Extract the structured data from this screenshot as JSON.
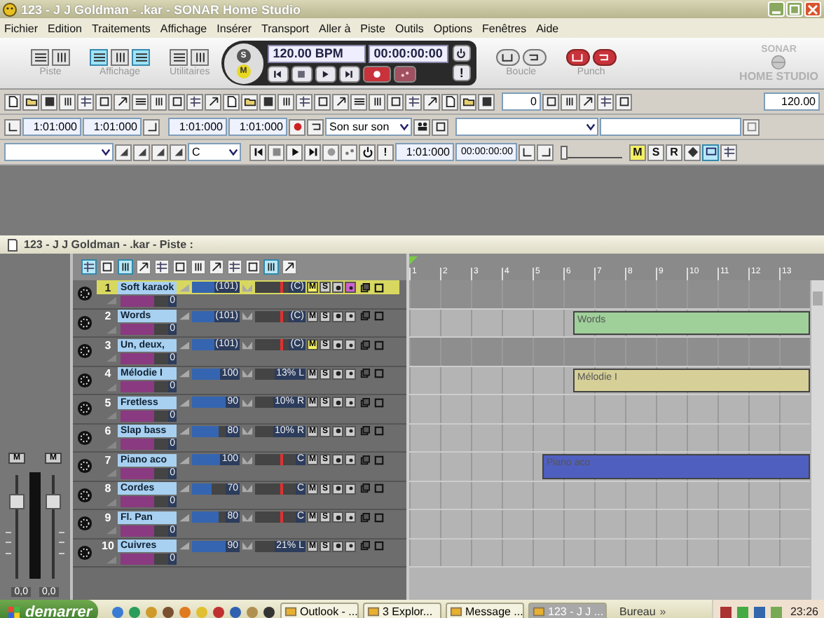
{
  "window": {
    "title": "123 - J J Goldman - .kar - SONAR Home Studio"
  },
  "menu": [
    "Fichier",
    "Edition",
    "Traitements",
    "Affichage",
    "Insérer",
    "Transport",
    "Aller à",
    "Piste",
    "Outils",
    "Options",
    "Fenêtres",
    "Aide"
  ],
  "main_toolbar": {
    "groups": [
      {
        "label": "Piste",
        "kind": "plain"
      },
      {
        "label": "Affichage",
        "kind": "view",
        "buttons": [
          {
            "on": true
          },
          {
            "on": false
          },
          {
            "on": true
          }
        ]
      },
      {
        "label": "Utilitaires",
        "kind": "plain"
      }
    ],
    "transport": {
      "mode_buttons": [
        {
          "label": "S",
          "on": false
        },
        {
          "label": "M",
          "on": true
        }
      ],
      "tempo": "120.00 BPM",
      "time": "00:00:00:00",
      "alert": "!"
    },
    "right_groups": [
      {
        "label": "Boucle",
        "kind": "plain"
      },
      {
        "label": "Punch",
        "kind": "punch",
        "buttons": [
          {
            "on": true
          },
          {
            "on": true
          }
        ]
      }
    ],
    "logo": {
      "line1": "SONAR",
      "line2": "HOME STUDIO"
    }
  },
  "toolbar2": {
    "fields": [
      "0",
      "120.00"
    ]
  },
  "toolbar3": {
    "times": [
      "1:01:000",
      "1:01:000",
      "1:01:000",
      "1:01:000"
    ],
    "mode_select": "Son sur son"
  },
  "toolbar4": {
    "key_select": "C",
    "alert": "!",
    "now": "1:01:000",
    "smpte": "00:00:00:00",
    "zoom": {
      "level": 0
    },
    "buttons": [
      {
        "label": "M",
        "on": true
      },
      {
        "label": "S",
        "on": false
      },
      {
        "label": "R",
        "on": false
      }
    ]
  },
  "track_window": {
    "title": "123 - J J Goldman - .kar - Piste :",
    "master": {
      "mute_buttons": [
        "M",
        "M"
      ],
      "readings": [
        "0,0",
        "0,0"
      ]
    },
    "ruler": [
      "1",
      "2",
      "3",
      "4",
      "5",
      "6",
      "7",
      "8",
      "9",
      "10",
      "11",
      "12",
      "13"
    ],
    "tracks": [
      {
        "number": "1",
        "mute_label": "M",
        "solo_label": "S",
        "name": "Soft karaok",
        "selected": true,
        "muted": true,
        "echo": true,
        "volume": {
          "reading": "(101)",
          "level": 0.95
        },
        "pan": {
          "reading": "(C)",
          "level": 0.5
        },
        "send": {
          "reading": "0",
          "level": 0.6
        }
      },
      {
        "number": "2",
        "mute_label": "M",
        "solo_label": "S",
        "name": "Words",
        "selected": false,
        "muted": false,
        "echo": false,
        "volume": {
          "reading": "(101)",
          "level": 0.95
        },
        "pan": {
          "reading": "(C)",
          "level": 0.5
        },
        "send": {
          "reading": "0",
          "level": 0.6
        },
        "clip": {
          "label": "Words",
          "color": "#9fd09a"
        }
      },
      {
        "number": "3",
        "mute_label": "M",
        "solo_label": "S",
        "name": "Un, deux,",
        "selected": false,
        "muted": true,
        "echo": false,
        "volume": {
          "reading": "(101)",
          "level": 0.95
        },
        "pan": {
          "reading": "(C)",
          "level": 0.5
        },
        "send": {
          "reading": "0",
          "level": 0.6
        }
      },
      {
        "number": "4",
        "mute_label": "M",
        "solo_label": "S",
        "name": "Mélodie I",
        "selected": false,
        "muted": false,
        "echo": false,
        "volume": {
          "reading": "100",
          "level": 0.9
        },
        "pan": {
          "reading": "13% L",
          "level": 0.43
        },
        "send": {
          "reading": "0",
          "level": 0.6
        },
        "clip": {
          "label": "Mélodie I",
          "color": "#d6cf98"
        }
      },
      {
        "number": "5",
        "mute_label": "M",
        "solo_label": "S",
        "name": "Fretless",
        "selected": false,
        "muted": false,
        "echo": false,
        "volume": {
          "reading": "90",
          "level": 0.7
        },
        "pan": {
          "reading": "10% R",
          "level": 0.55
        },
        "send": {
          "reading": "0",
          "level": 0.6
        }
      },
      {
        "number": "6",
        "mute_label": "M",
        "solo_label": "S",
        "name": "Slap bass",
        "selected": false,
        "muted": false,
        "echo": false,
        "volume": {
          "reading": "80",
          "level": 0.55
        },
        "pan": {
          "reading": "10% R",
          "level": 0.55
        },
        "send": {
          "reading": "0",
          "level": 0.6
        }
      },
      {
        "number": "7",
        "mute_label": "M",
        "solo_label": "S",
        "name": "Piano aco",
        "selected": false,
        "muted": false,
        "echo": false,
        "volume": {
          "reading": "100",
          "level": 0.9
        },
        "pan": {
          "reading": "C",
          "level": 0.5
        },
        "send": {
          "reading": "0",
          "level": 0.6
        },
        "clip": {
          "label": "Piano aco",
          "color": "#4f5fc0"
        }
      },
      {
        "number": "8",
        "mute_label": "M",
        "solo_label": "S",
        "name": "Cordes",
        "selected": false,
        "muted": false,
        "echo": false,
        "volume": {
          "reading": "70",
          "level": 0.4
        },
        "pan": {
          "reading": "C",
          "level": 0.5
        },
        "send": {
          "reading": "0",
          "level": 0.6
        }
      },
      {
        "number": "9",
        "mute_label": "M",
        "solo_label": "S",
        "name": "Fl. Pan",
        "selected": false,
        "muted": false,
        "echo": false,
        "volume": {
          "reading": "80",
          "level": 0.55
        },
        "pan": {
          "reading": "C",
          "level": 0.5
        },
        "send": {
          "reading": "0",
          "level": 0.6
        }
      },
      {
        "number": "10",
        "mute_label": "M",
        "solo_label": "S",
        "name": "Cuivres",
        "selected": false,
        "muted": false,
        "echo": false,
        "volume": {
          "reading": "90",
          "level": 0.7
        },
        "pan": {
          "reading": "21% L",
          "level": 0.4
        },
        "send": {
          "reading": "0",
          "level": 0.6
        }
      }
    ]
  },
  "taskbar": {
    "start": "demarrer",
    "tasks": [
      {
        "label": "Outlook - ...",
        "selected": false
      },
      {
        "label": "3 Explor...",
        "selected": false
      },
      {
        "label": "Message ...",
        "selected": false
      },
      {
        "label": "123 - J J ...",
        "selected": true
      }
    ],
    "toolbar_label": "Bureau",
    "more": "»",
    "clock": "23:26"
  }
}
